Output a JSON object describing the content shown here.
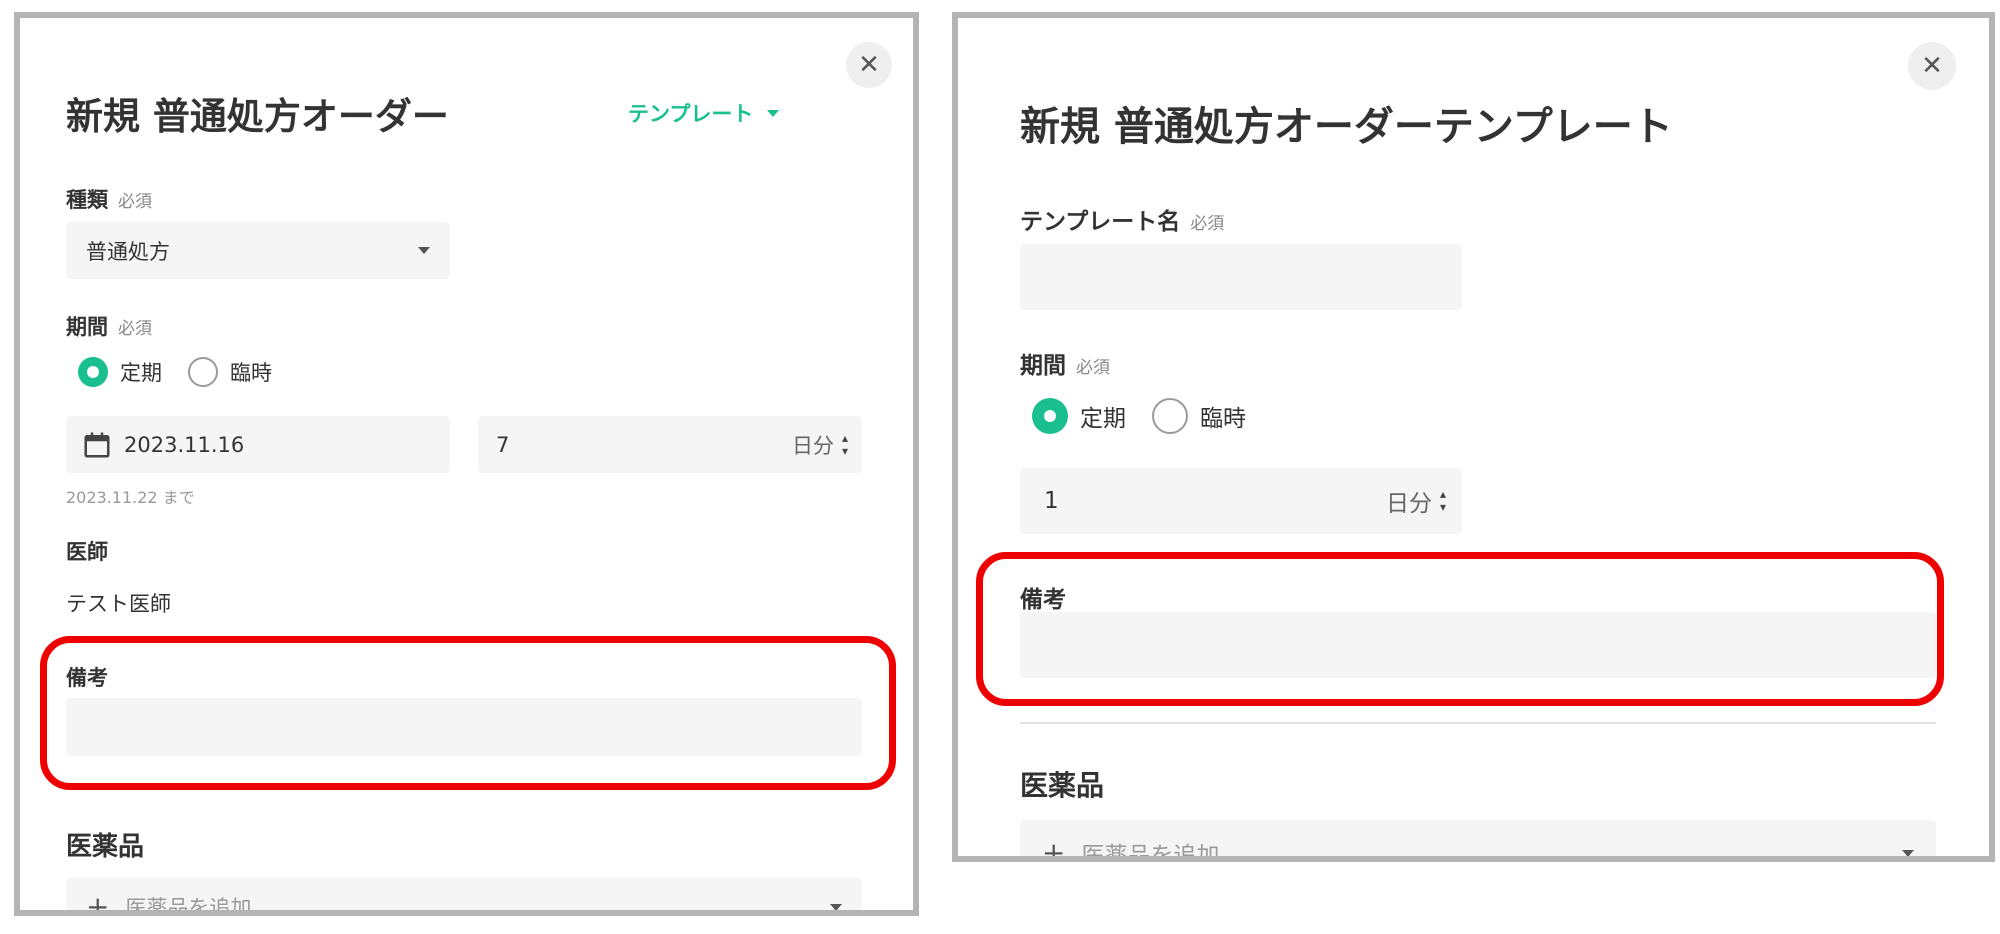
{
  "colors": {
    "accent": "#19bf8f",
    "highlight": "#ee0000",
    "field_bg": "#f5f5f5",
    "frame": "#b4b4b4"
  },
  "left": {
    "close_glyph": "✕",
    "title": "新規 普通処方オーダー",
    "template_button": "テンプレート",
    "type": {
      "label": "種類",
      "required": "必須",
      "value": "普通処方"
    },
    "period": {
      "label": "期間",
      "required": "必須",
      "options": [
        "定期",
        "臨時"
      ],
      "selected": "定期",
      "date": "2023.11.16",
      "days": "7",
      "unit": "日分",
      "until": "2023.11.22 まで"
    },
    "doctor": {
      "label": "医師",
      "value": "テスト医師"
    },
    "notes": {
      "label": "備考",
      "value": ""
    },
    "medicine": {
      "label": "医薬品",
      "add_placeholder": "医薬品を追加",
      "plus": "+"
    }
  },
  "right": {
    "close_glyph": "✕",
    "title": "新規 普通処方オーダーテンプレート",
    "template_name": {
      "label": "テンプレート名",
      "required": "必須",
      "value": ""
    },
    "period": {
      "label": "期間",
      "required": "必須",
      "options": [
        "定期",
        "臨時"
      ],
      "selected": "定期",
      "days": "1",
      "unit": "日分"
    },
    "notes": {
      "label": "備考",
      "value": ""
    },
    "medicine": {
      "label": "医薬品",
      "add_placeholder": "医薬品を追加",
      "plus": "+"
    }
  }
}
